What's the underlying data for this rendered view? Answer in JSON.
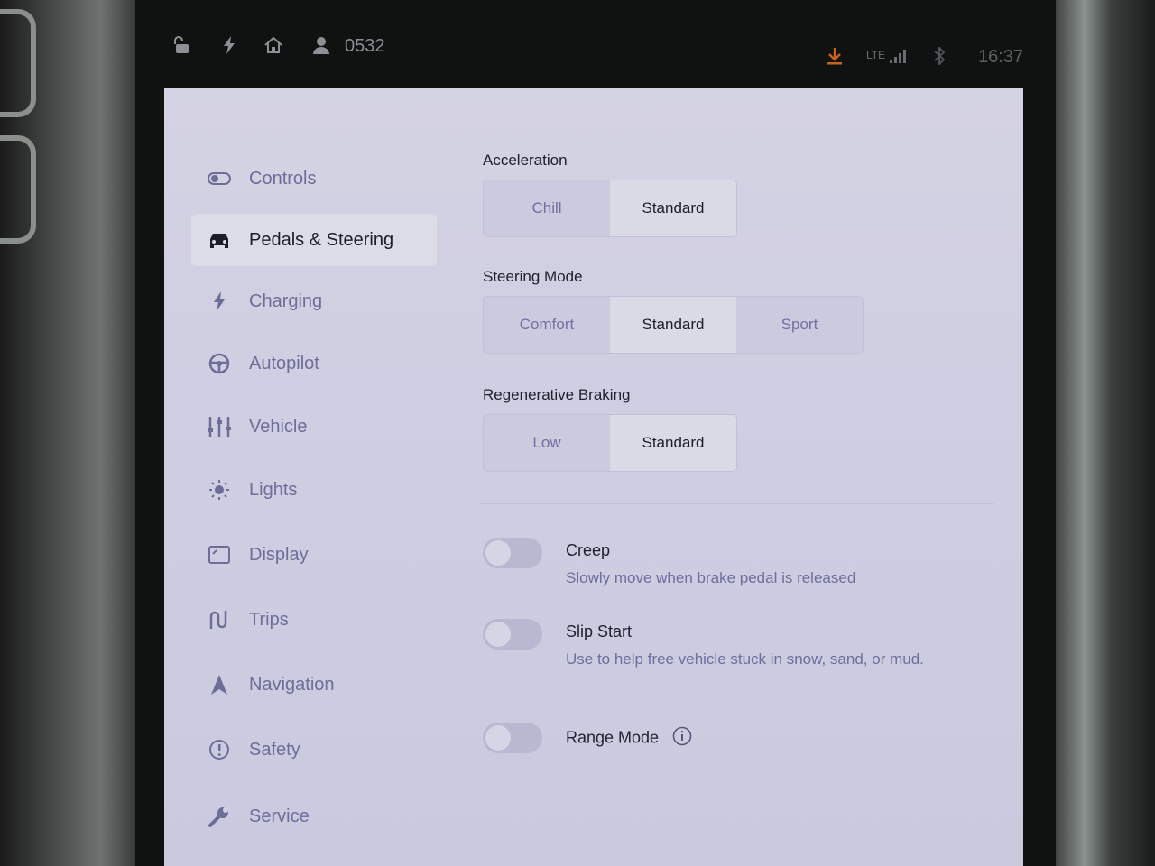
{
  "status_bar": {
    "lock_icon": "lock-open-icon",
    "bolt_icon": "bolt-icon",
    "home_icon": "home-icon",
    "user_icon": "user-icon",
    "profile_code": "0532",
    "download_icon": "download-icon",
    "signal_label": "LTE",
    "bluetooth_icon": "bluetooth-icon",
    "time": "16:37",
    "download_color": "#c8621e"
  },
  "sidebar": {
    "items": [
      {
        "label": "Controls",
        "icon": "toggle-icon"
      },
      {
        "label": "Pedals & Steering",
        "icon": "car-icon",
        "active": true
      },
      {
        "label": "Charging",
        "icon": "bolt-icon"
      },
      {
        "label": "Autopilot",
        "icon": "steering-wheel-icon"
      },
      {
        "label": "Vehicle",
        "icon": "sliders-icon"
      },
      {
        "label": "Lights",
        "icon": "sun-icon"
      },
      {
        "label": "Display",
        "icon": "display-icon"
      },
      {
        "label": "Trips",
        "icon": "trips-icon"
      },
      {
        "label": "Navigation",
        "icon": "navigation-arrow-icon"
      },
      {
        "label": "Safety",
        "icon": "alert-circle-icon"
      },
      {
        "label": "Service",
        "icon": "wrench-icon"
      }
    ]
  },
  "settings": {
    "acceleration": {
      "title": "Acceleration",
      "options": [
        "Chill",
        "Standard"
      ],
      "selected": "Standard"
    },
    "steering_mode": {
      "title": "Steering Mode",
      "options": [
        "Comfort",
        "Standard",
        "Sport"
      ],
      "selected": "Standard"
    },
    "regen_braking": {
      "title": "Regenerative Braking",
      "options": [
        "Low",
        "Standard"
      ],
      "selected": "Standard"
    },
    "toggles": [
      {
        "title": "Creep",
        "description": "Slowly move when brake pedal is released",
        "on": false
      },
      {
        "title": "Slip Start",
        "description": "Use to help free vehicle stuck in snow, sand, or mud.",
        "on": false
      },
      {
        "title": "Range Mode",
        "description": "",
        "on": false,
        "info_icon": "info-icon"
      }
    ]
  }
}
